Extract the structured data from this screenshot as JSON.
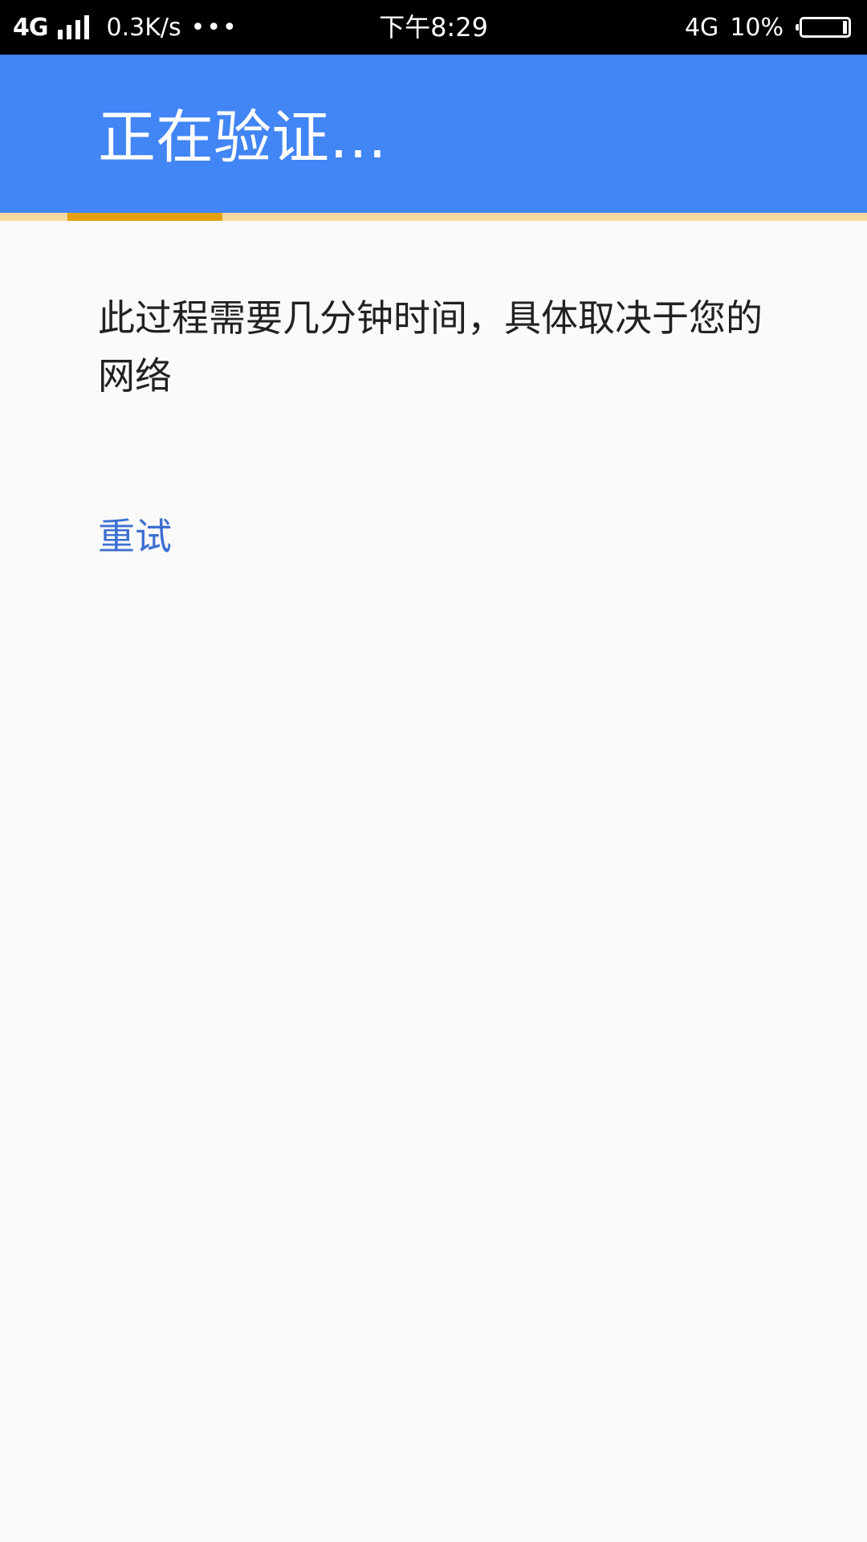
{
  "status_bar": {
    "network_left": "4G",
    "net_speed": "0.3K/s",
    "more": "•••",
    "time": "下午8:29",
    "network_right": "4G",
    "battery_percent": "10%",
    "battery_level": 0.1
  },
  "header": {
    "title": "正在验证…"
  },
  "progress": {
    "state": "indeterminate"
  },
  "main": {
    "message": "此过程需要几分钟时间，具体取决于您的网络",
    "retry_label": "重试"
  },
  "colors": {
    "app_bar": "#4285f4",
    "progress": "#e3a00c",
    "link": "#3c6fd1"
  }
}
